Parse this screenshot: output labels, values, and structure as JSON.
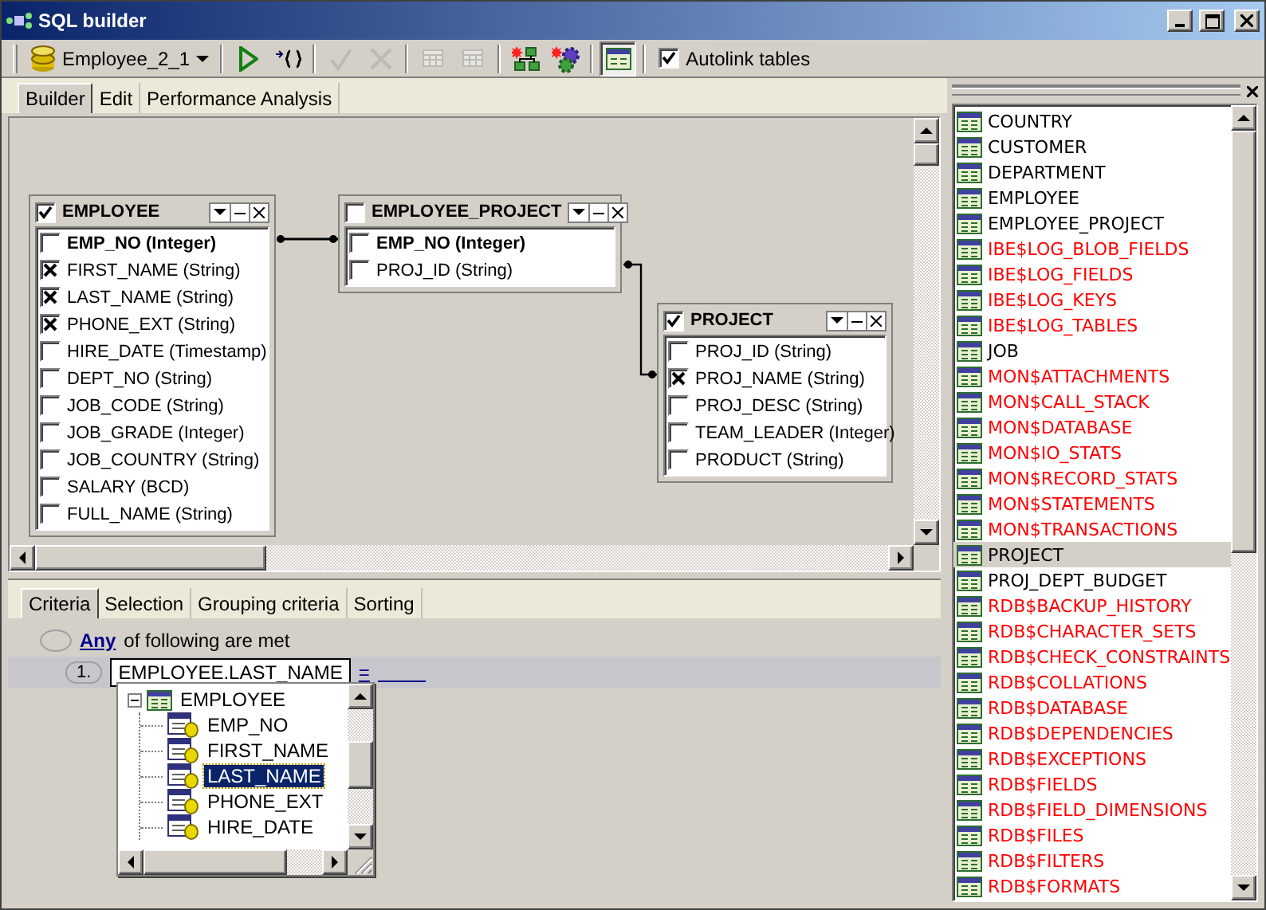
{
  "window": {
    "title": "SQL builder"
  },
  "toolbar": {
    "database": {
      "label": "Employee_2_1"
    },
    "buttons": [
      {
        "kind": "run",
        "disabled": false,
        "pressed": false
      },
      {
        "kind": "format",
        "disabled": false,
        "pressed": false
      },
      {
        "kind": "commit",
        "disabled": true,
        "pressed": false
      },
      {
        "kind": "rollback",
        "disabled": true,
        "pressed": false
      },
      {
        "kind": "grid",
        "disabled": true,
        "pressed": false
      },
      {
        "kind": "grid",
        "disabled": true,
        "pressed": false
      },
      {
        "kind": "diagram",
        "disabled": false,
        "pressed": false
      },
      {
        "kind": "gears",
        "disabled": false,
        "pressed": false
      },
      {
        "kind": "panel",
        "disabled": false,
        "pressed": true
      }
    ],
    "autolink": {
      "label": "Autolink tables",
      "checked": true
    }
  },
  "tabs": [
    {
      "label": "Builder",
      "selected": true
    },
    {
      "label": "Edit",
      "selected": false
    },
    {
      "label": "Performance Analysis",
      "selected": false
    }
  ],
  "diagram": {
    "tables": [
      {
        "name": "EMPLOYEE",
        "checked": true,
        "fields": [
          {
            "label": "EMP_NO (Integer)",
            "key": true,
            "checked": false
          },
          {
            "label": "FIRST_NAME (String)",
            "key": false,
            "checked": true
          },
          {
            "label": "LAST_NAME (String)",
            "key": false,
            "checked": true
          },
          {
            "label": "PHONE_EXT (String)",
            "key": false,
            "checked": true
          },
          {
            "label": "HIRE_DATE (Timestamp)",
            "key": false,
            "checked": false
          },
          {
            "label": "DEPT_NO (String)",
            "key": false,
            "checked": false
          },
          {
            "label": "JOB_CODE (String)",
            "key": false,
            "checked": false
          },
          {
            "label": "JOB_GRADE (Integer)",
            "key": false,
            "checked": false
          },
          {
            "label": "JOB_COUNTRY (String)",
            "key": false,
            "checked": false
          },
          {
            "label": "SALARY (BCD)",
            "key": false,
            "checked": false
          },
          {
            "label": "FULL_NAME (String)",
            "key": false,
            "checked": false
          }
        ]
      },
      {
        "name": "EMPLOYEE_PROJECT",
        "checked": false,
        "fields": [
          {
            "label": "EMP_NO (Integer)",
            "key": true,
            "checked": false
          },
          {
            "label": "PROJ_ID (String)",
            "key": false,
            "checked": false
          }
        ]
      },
      {
        "name": "PROJECT",
        "checked": true,
        "fields": [
          {
            "label": "PROJ_ID (String)",
            "key": false,
            "checked": false
          },
          {
            "label": "PROJ_NAME (String)",
            "key": false,
            "checked": true
          },
          {
            "label": "PROJ_DESC (String)",
            "key": false,
            "checked": false
          },
          {
            "label": "TEAM_LEADER (Integer)",
            "key": false,
            "checked": false
          },
          {
            "label": "PRODUCT (String)",
            "key": false,
            "checked": false
          }
        ]
      }
    ]
  },
  "criteria_tabs": [
    {
      "label": "Criteria",
      "selected": true
    },
    {
      "label": "Selection",
      "selected": false
    },
    {
      "label": "Grouping criteria",
      "selected": false
    },
    {
      "label": "Sorting",
      "selected": false
    }
  ],
  "criteria": {
    "quantifier": "Any",
    "text": "of following are met",
    "conditions": [
      {
        "number": "1.",
        "field": "EMPLOYEE.LAST_NAME",
        "operator": "="
      }
    ]
  },
  "field_picker": {
    "root": {
      "label": "EMPLOYEE",
      "expanded": true,
      "children": [
        {
          "label": "EMP_NO",
          "selected": false
        },
        {
          "label": "FIRST_NAME",
          "selected": false
        },
        {
          "label": "LAST_NAME",
          "selected": true
        },
        {
          "label": "PHONE_EXT",
          "selected": false
        },
        {
          "label": "HIRE_DATE",
          "selected": false
        }
      ]
    }
  },
  "tables_list": [
    {
      "name": "COUNTRY",
      "color": "#000000",
      "selected": false
    },
    {
      "name": "CUSTOMER",
      "color": "#000000",
      "selected": false
    },
    {
      "name": "DEPARTMENT",
      "color": "#000000",
      "selected": false
    },
    {
      "name": "EMPLOYEE",
      "color": "#000000",
      "selected": false
    },
    {
      "name": "EMPLOYEE_PROJECT",
      "color": "#000000",
      "selected": false
    },
    {
      "name": "IBE$LOG_BLOB_FIELDS",
      "color": "#ff0000",
      "selected": false
    },
    {
      "name": "IBE$LOG_FIELDS",
      "color": "#ff0000",
      "selected": false
    },
    {
      "name": "IBE$LOG_KEYS",
      "color": "#ff0000",
      "selected": false
    },
    {
      "name": "IBE$LOG_TABLES",
      "color": "#ff0000",
      "selected": false
    },
    {
      "name": "JOB",
      "color": "#000000",
      "selected": false
    },
    {
      "name": "MON$ATTACHMENTS",
      "color": "#ff0000",
      "selected": false
    },
    {
      "name": "MON$CALL_STACK",
      "color": "#ff0000",
      "selected": false
    },
    {
      "name": "MON$DATABASE",
      "color": "#ff0000",
      "selected": false
    },
    {
      "name": "MON$IO_STATS",
      "color": "#ff0000",
      "selected": false
    },
    {
      "name": "MON$RECORD_STATS",
      "color": "#ff0000",
      "selected": false
    },
    {
      "name": "MON$STATEMENTS",
      "color": "#ff0000",
      "selected": false
    },
    {
      "name": "MON$TRANSACTIONS",
      "color": "#ff0000",
      "selected": false
    },
    {
      "name": "PROJECT",
      "color": "#000000",
      "selected": true
    },
    {
      "name": "PROJ_DEPT_BUDGET",
      "color": "#000000",
      "selected": false
    },
    {
      "name": "RDB$BACKUP_HISTORY",
      "color": "#ff0000",
      "selected": false
    },
    {
      "name": "RDB$CHARACTER_SETS",
      "color": "#ff0000",
      "selected": false
    },
    {
      "name": "RDB$CHECK_CONSTRAINTS",
      "color": "#ff0000",
      "selected": false
    },
    {
      "name": "RDB$COLLATIONS",
      "color": "#ff0000",
      "selected": false
    },
    {
      "name": "RDB$DATABASE",
      "color": "#ff0000",
      "selected": false
    },
    {
      "name": "RDB$DEPENDENCIES",
      "color": "#ff0000",
      "selected": false
    },
    {
      "name": "RDB$EXCEPTIONS",
      "color": "#ff0000",
      "selected": false
    },
    {
      "name": "RDB$FIELDS",
      "color": "#ff0000",
      "selected": false
    },
    {
      "name": "RDB$FIELD_DIMENSIONS",
      "color": "#ff0000",
      "selected": false
    },
    {
      "name": "RDB$FILES",
      "color": "#ff0000",
      "selected": false
    },
    {
      "name": "RDB$FILTERS",
      "color": "#ff0000",
      "selected": false
    },
    {
      "name": "RDB$FORMATS",
      "color": "#ff0000",
      "selected": false
    }
  ]
}
